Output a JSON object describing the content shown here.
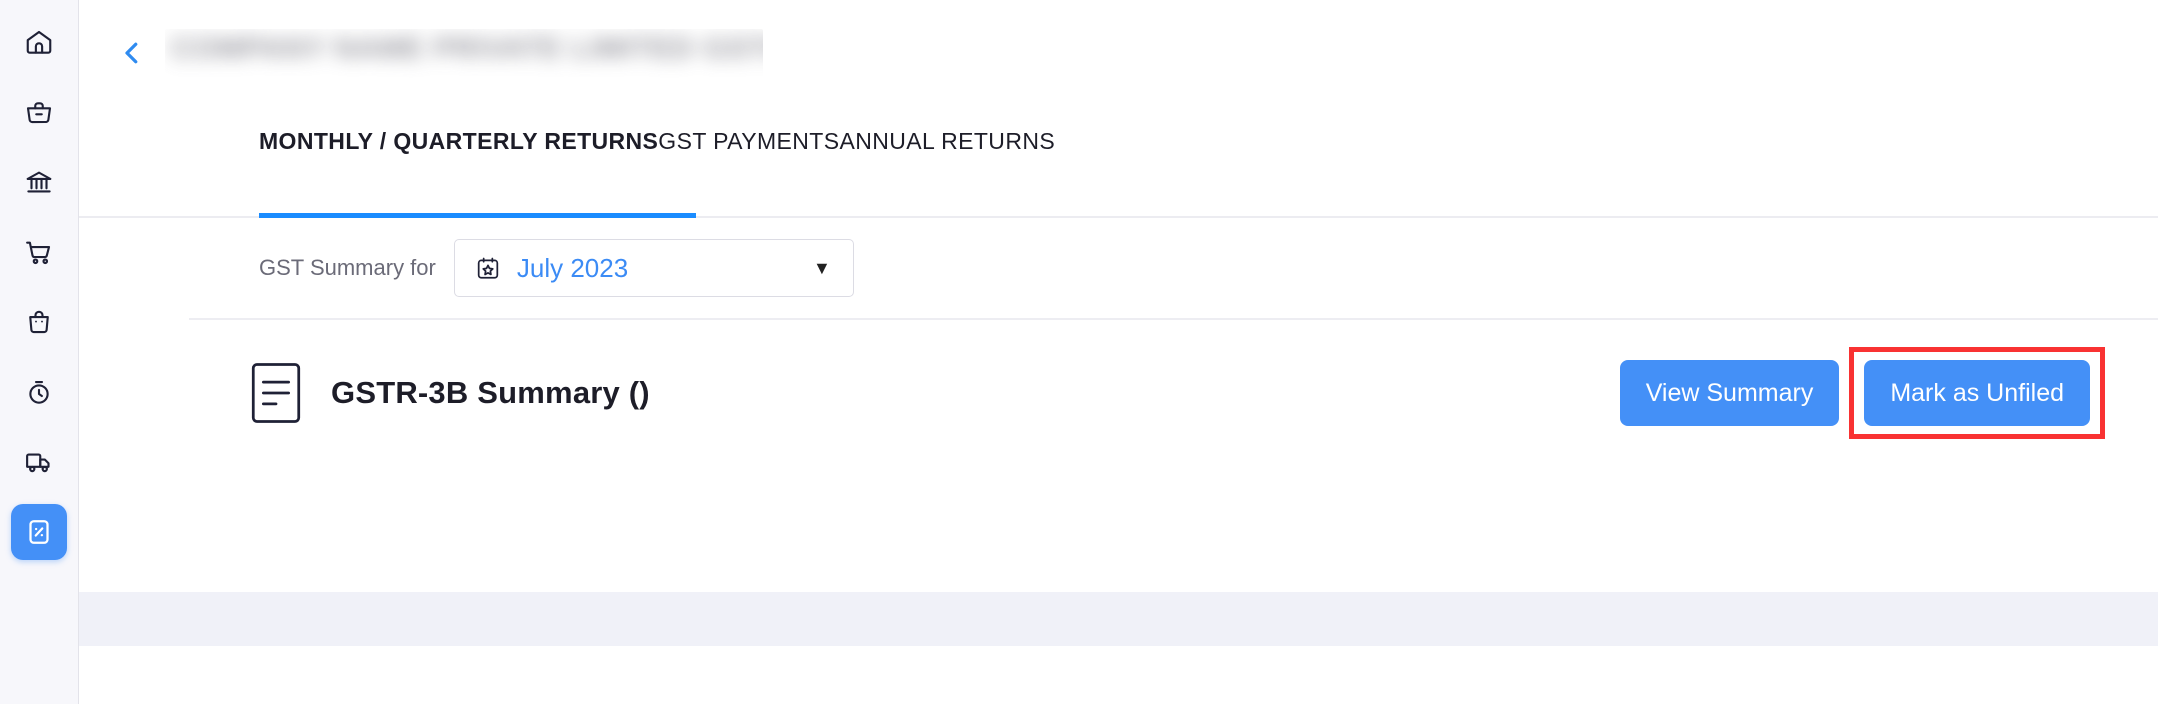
{
  "sidebar": {
    "items": [
      {
        "name": "home",
        "icon": "home-icon",
        "active": false
      },
      {
        "name": "purchases",
        "icon": "briefcase-icon",
        "active": false
      },
      {
        "name": "banking",
        "icon": "bank-icon",
        "active": false
      },
      {
        "name": "sales",
        "icon": "shopping-cart-icon",
        "active": false
      },
      {
        "name": "inventory",
        "icon": "shopping-bag-icon",
        "active": false
      },
      {
        "name": "timesheet",
        "icon": "stopwatch-icon",
        "active": false
      },
      {
        "name": "shipping",
        "icon": "truck-icon",
        "active": false
      },
      {
        "name": "gst",
        "icon": "tax-percent-icon",
        "active": true
      }
    ]
  },
  "header": {
    "back_label": "Back",
    "title_redacted": "COMPANY NAME PRIVATE LIMITED  GSTIN 29AB"
  },
  "tabs": [
    {
      "label": "MONTHLY / QUARTERLY RETURNS",
      "active": true
    },
    {
      "label": "GST PAYMENTS",
      "active": false
    },
    {
      "label": "ANNUAL RETURNS",
      "active": false
    }
  ],
  "selector": {
    "label": "GST Summary for",
    "icon": "calendar-star-icon",
    "value": "July 2023",
    "caret": "▼"
  },
  "return_summary": {
    "icon": "document-lines-icon",
    "title": "GSTR-3B Summary ()",
    "view_button": "View Summary",
    "mark_button": "Mark as Unfiled"
  },
  "colors": {
    "accent_blue": "#4490f7",
    "tab_underline": "#1a8cff",
    "link_blue": "#3b8bf5",
    "annotation_red": "#f93232",
    "band": "#f0f1f8",
    "sidebar_bg": "#f7f7fb",
    "text_dark": "#1d1d28",
    "text_muted": "#6b6b78"
  }
}
